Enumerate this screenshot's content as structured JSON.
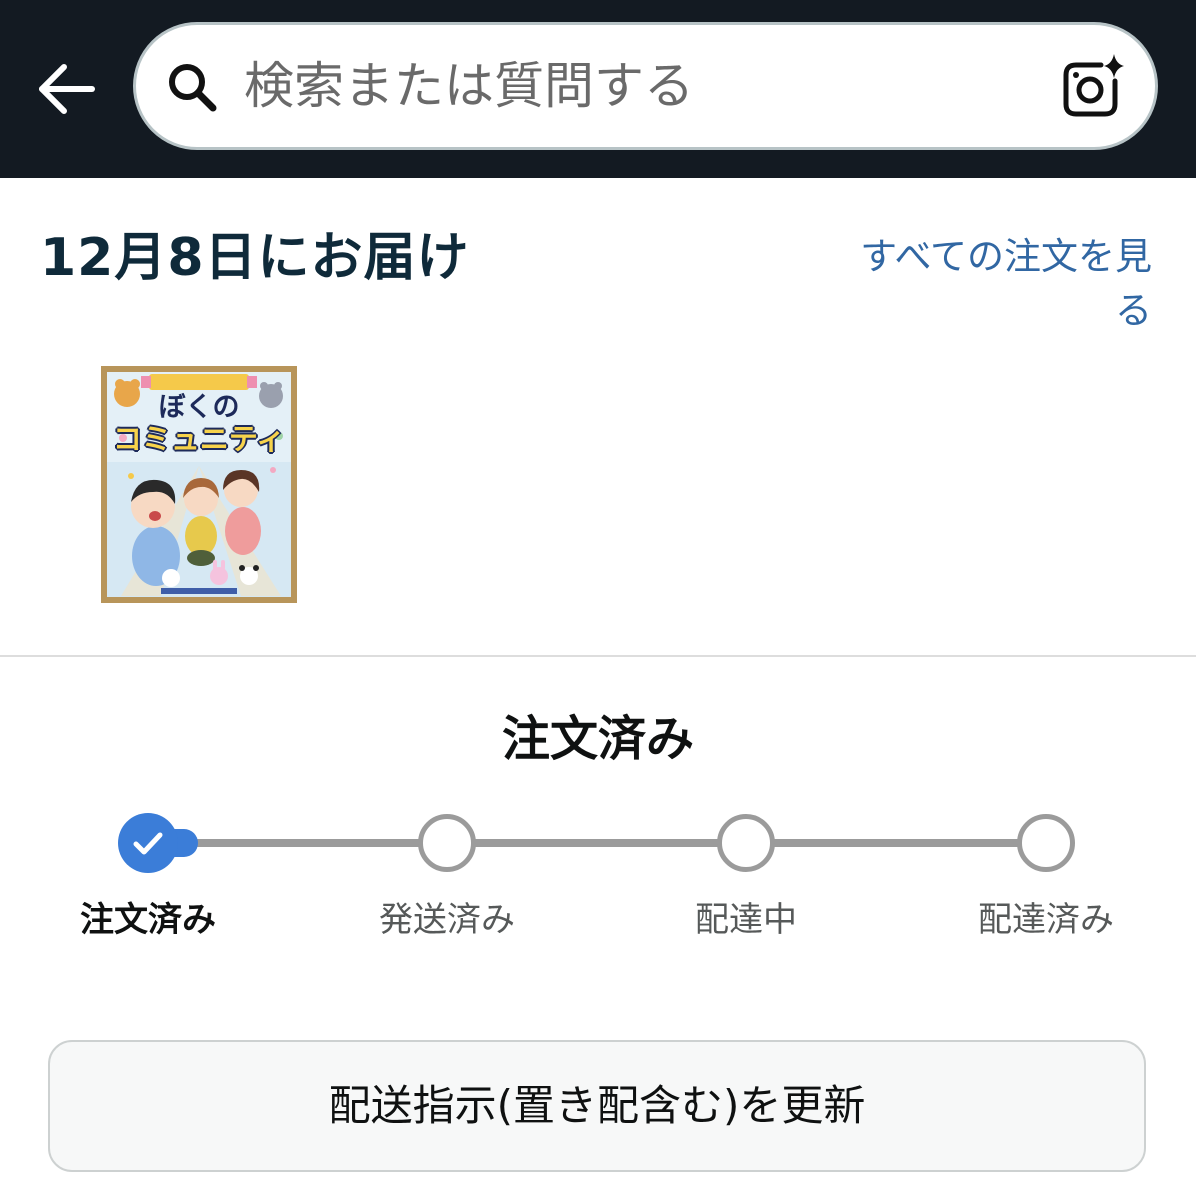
{
  "header": {
    "back_icon": "arrow-left-icon",
    "search": {
      "placeholder": "検索または質問する",
      "value": "",
      "search_icon": "search-icon",
      "camera_icon": "camera-lens-icon"
    }
  },
  "delivery": {
    "title": "12月8日にお届け",
    "view_all_orders_link": "すべての注文を見る"
  },
  "product": {
    "cover": {
      "title_line1": "ぼくの",
      "title_line2": "コミュニティ"
    }
  },
  "tracker": {
    "status_title": "注文済み",
    "completed_steps": 1,
    "steps": [
      {
        "label": "注文済み",
        "state": "complete",
        "icon": "check-icon"
      },
      {
        "label": "発送済み",
        "state": "pending"
      },
      {
        "label": "配達中",
        "state": "pending"
      },
      {
        "label": "配達済み",
        "state": "pending"
      }
    ]
  },
  "actions": {
    "update_delivery_instructions_label": "配送指示(置き配含む)を更新"
  },
  "colors": {
    "header_bg": "#131a22",
    "accent_blue": "#3b7dd8",
    "link": "#3167a3",
    "heading": "#0f2a3a",
    "track_gray": "#9b9b9b"
  }
}
